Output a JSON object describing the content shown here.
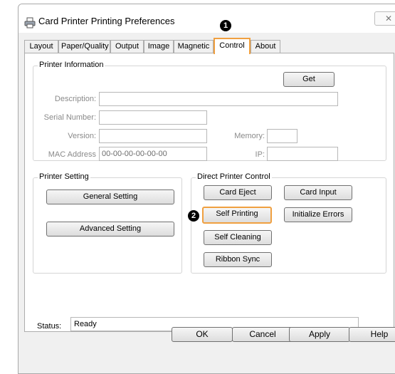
{
  "window": {
    "title": "Card Printer Printing Preferences",
    "close_glyph": "✕"
  },
  "tabs": [
    {
      "label": "Layout"
    },
    {
      "label": "Paper/Quality"
    },
    {
      "label": "Output"
    },
    {
      "label": "Image"
    },
    {
      "label": "Magnetic"
    },
    {
      "label": "Control",
      "active": true
    },
    {
      "label": "About"
    }
  ],
  "markers": {
    "one": "1",
    "two": "2"
  },
  "printer_information": {
    "group_title": "Printer Information",
    "get_button": "Get",
    "description_label": "Description:",
    "description_value": "",
    "serial_label": "Serial Number:",
    "serial_value": "",
    "version_label": "Version:",
    "version_value": "",
    "memory_label": "Memory:",
    "memory_value": "",
    "mac_label": "MAC Address",
    "mac_value": "00-00-00-00-00-00",
    "ip_label": "IP:",
    "ip_value": ""
  },
  "printer_setting": {
    "group_title": "Printer Setting",
    "general_button": "General Setting",
    "advanced_button": "Advanced Setting"
  },
  "direct_control": {
    "group_title": "Direct Printer Control",
    "card_eject": "Card Eject",
    "card_input": "Card Input",
    "self_printing": "Self Printing",
    "initialize_errors": "Initialize Errors",
    "self_cleaning": "Self Cleaning",
    "ribbon_sync": "Ribbon Sync"
  },
  "status": {
    "label": "Status:",
    "value": "Ready"
  },
  "footer": {
    "ok": "OK",
    "cancel": "Cancel",
    "apply": "Apply",
    "help": "Help"
  },
  "colors": {
    "highlight": "#f0a040",
    "window_bg": "#f0f0f0"
  },
  "icons": {
    "app": "printer-icon",
    "close": "close-icon"
  }
}
